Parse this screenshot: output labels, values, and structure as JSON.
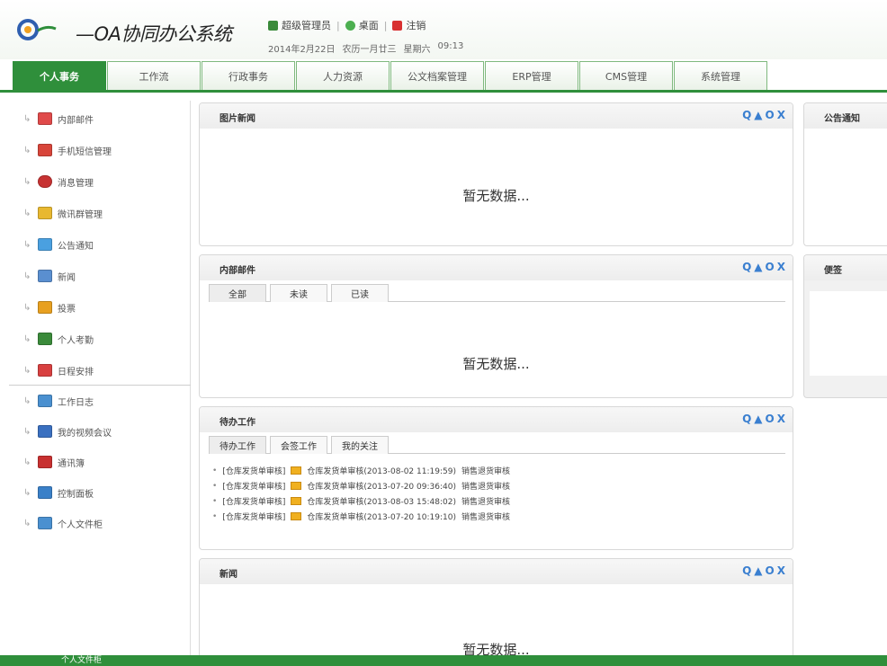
{
  "header": {
    "app_title": "—OA协同办公系统",
    "user_label": "超级管理员",
    "desktop_label": "桌面",
    "logout_label": "注销",
    "date": "2014年2月22日",
    "lunar": "农历一月廿三",
    "weekday": "星期六",
    "time": "09:13"
  },
  "nav": {
    "tabs": [
      {
        "label": "个人事务",
        "active": true
      },
      {
        "label": "工作流"
      },
      {
        "label": "行政事务"
      },
      {
        "label": "人力资源"
      },
      {
        "label": "公文档案管理"
      },
      {
        "label": "ERP管理"
      },
      {
        "label": "CMS管理"
      },
      {
        "label": "系统管理"
      }
    ]
  },
  "sidebar": {
    "items": [
      {
        "label": "内部邮件",
        "icon": "mail-icon",
        "color": "#e04a4a"
      },
      {
        "label": "手机短信管理",
        "icon": "mobile-icon",
        "color": "#d8453a"
      },
      {
        "label": "消息管理",
        "icon": "message-icon",
        "color": "#c73232"
      },
      {
        "label": "微讯群管理",
        "icon": "group-icon",
        "color": "#e8b830"
      },
      {
        "label": "公告通知",
        "icon": "notice-icon",
        "color": "#4aa0e0"
      },
      {
        "label": "新闻",
        "icon": "news-icon",
        "color": "#5a8fd0"
      },
      {
        "label": "投票",
        "icon": "vote-icon",
        "color": "#e8a020"
      },
      {
        "label": "个人考勤",
        "icon": "attendance-icon",
        "color": "#3a8a3a"
      },
      {
        "label": "日程安排",
        "icon": "calendar-icon",
        "color": "#d84040"
      },
      {
        "label": "工作日志",
        "icon": "log-icon",
        "color": "#4a90d0"
      },
      {
        "label": "我的视频会议",
        "icon": "video-icon",
        "color": "#3a70c0"
      },
      {
        "label": "通讯簿",
        "icon": "contacts-icon",
        "color": "#c83030"
      },
      {
        "label": "控制面板",
        "icon": "control-panel-icon",
        "color": "#3a80c8"
      },
      {
        "label": "个人文件柜",
        "icon": "file-cabinet-icon",
        "color": "#4a90d0"
      }
    ]
  },
  "panels": {
    "photo_news": {
      "title": "图片新闻",
      "empty": "暂无数据..."
    },
    "internal_mail": {
      "title": "内部邮件",
      "tabs": [
        "全部",
        "未读",
        "已读"
      ],
      "empty": "暂无数据..."
    },
    "todo": {
      "title": "待办工作",
      "tabs": [
        "待办工作",
        "会签工作",
        "我的关注"
      ],
      "rows": [
        {
          "tag": "[仓库发货单审核]",
          "text": "仓库发货单审核(2013-08-02 11:19:59)",
          "step": "销售退货审核"
        },
        {
          "tag": "[仓库发货单审核]",
          "text": "仓库发货单审核(2013-07-20 09:36:40)",
          "step": "销售退货审核"
        },
        {
          "tag": "[仓库发货单审核]",
          "text": "仓库发货单审核(2013-08-03 15:48:02)",
          "step": "销售退货审核"
        },
        {
          "tag": "[仓库发货单审核]",
          "text": "仓库发货单审核(2013-07-20 10:19:10)",
          "step": "销售退货审核"
        }
      ]
    },
    "news": {
      "title": "新闻",
      "empty": "暂无数据..."
    },
    "notice": {
      "title": "公告通知"
    },
    "memo": {
      "title": "便签"
    }
  },
  "tools": {
    "search": "Q",
    "up": "▲",
    "refresh": "O",
    "close": "X"
  },
  "footer": {
    "label": "个人文件柜"
  }
}
